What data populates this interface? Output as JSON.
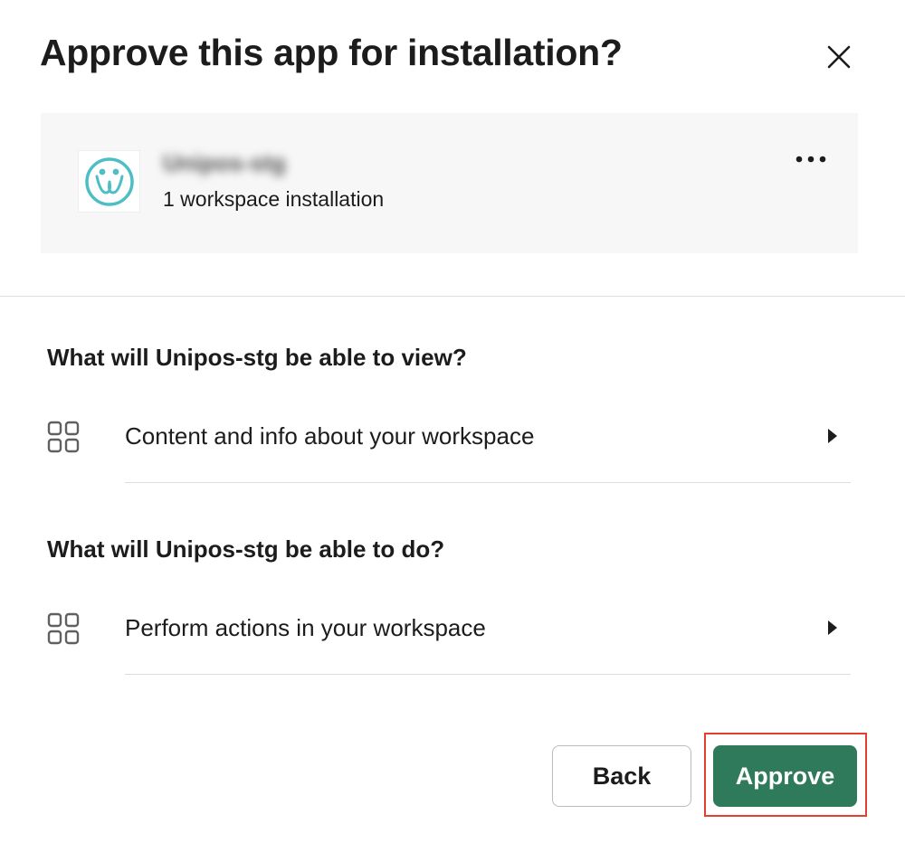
{
  "dialog": {
    "title": "Approve this app for installation?",
    "close_icon": "close-icon"
  },
  "app": {
    "name": "Unipos-stg",
    "installations": "1 workspace installation",
    "logo_icon": "unipos-logo",
    "more_icon": "more-horizontal-icon"
  },
  "sections": [
    {
      "heading": "What will Unipos-stg be able to view?",
      "items": [
        {
          "label": "Content and info about your workspace",
          "icon": "grid-icon",
          "arrow": "caret-right-icon"
        }
      ]
    },
    {
      "heading": "What will Unipos-stg be able to do?",
      "items": [
        {
          "label": "Perform actions in your workspace",
          "icon": "grid-icon",
          "arrow": "caret-right-icon"
        }
      ]
    }
  ],
  "footer": {
    "back_label": "Back",
    "approve_label": "Approve"
  },
  "colors": {
    "approve_button": "#2f7a5a",
    "highlight_outline": "#e0402f",
    "logo_teal": "#4dbfc4"
  }
}
